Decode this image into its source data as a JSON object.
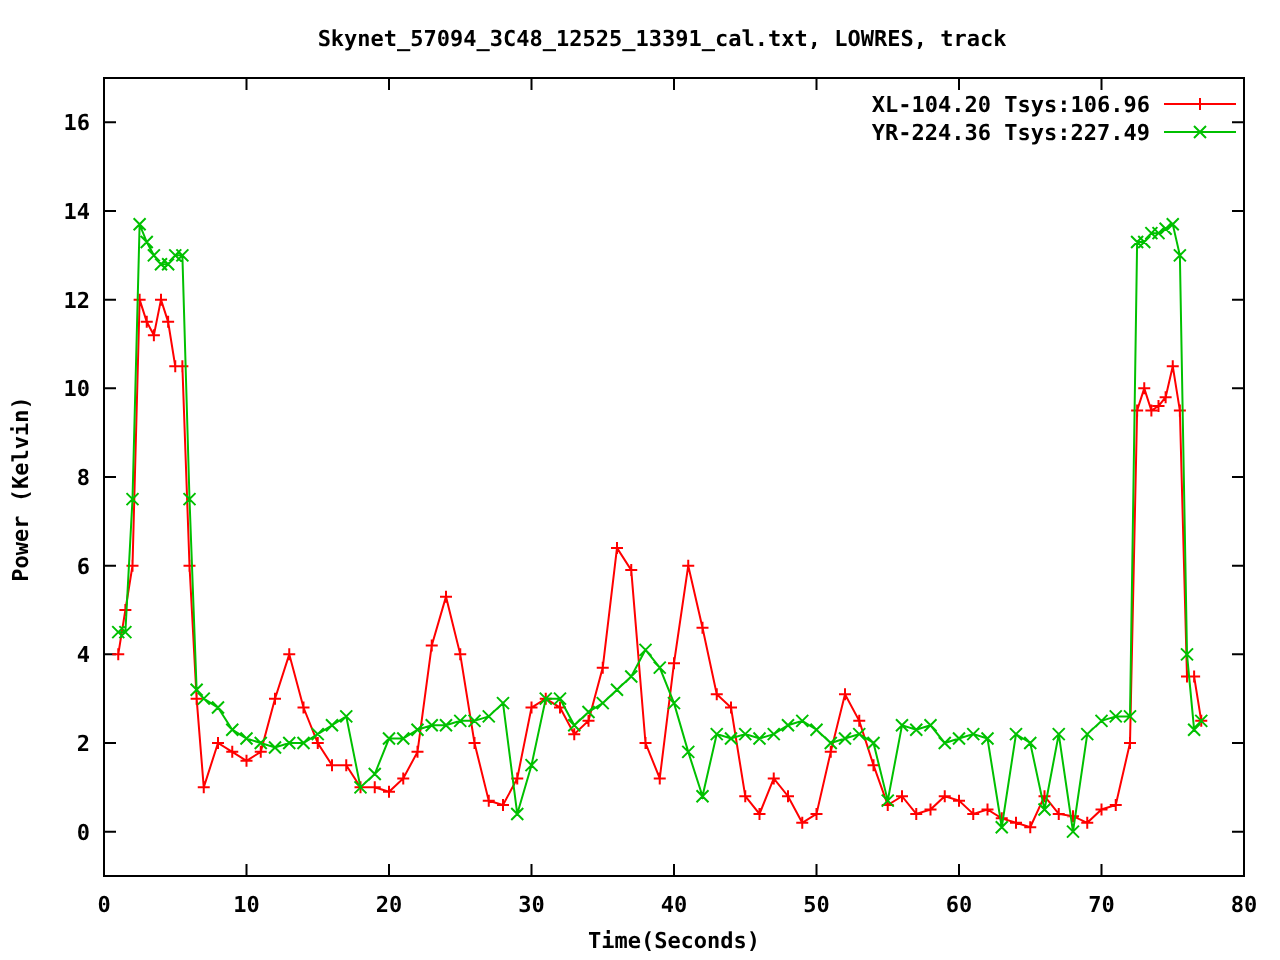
{
  "chart_data": {
    "type": "line",
    "title": "Skynet_57094_3C48_12525_13391_cal.txt, LOWRES, track",
    "xlabel": "Time(Seconds)",
    "ylabel": "Power (Kelvin)",
    "x": [
      1,
      1.5,
      2,
      2.5,
      3,
      3.5,
      4,
      4.5,
      5,
      5.5,
      6,
      6.5,
      7,
      8,
      9,
      10,
      11,
      12,
      13,
      14,
      15,
      16,
      17,
      18,
      19,
      20,
      21,
      22,
      23,
      24,
      25,
      26,
      27,
      28,
      29,
      30,
      31,
      32,
      33,
      34,
      35,
      36,
      37,
      38,
      39,
      40,
      41,
      42,
      43,
      44,
      45,
      46,
      47,
      48,
      49,
      50,
      51,
      52,
      53,
      54,
      55,
      56,
      57,
      58,
      59,
      60,
      61,
      62,
      63,
      64,
      65,
      66,
      67,
      68,
      69,
      70,
      71,
      72,
      72.5,
      73,
      73.5,
      74,
      74.5,
      75,
      75.5,
      76,
      76.5,
      77
    ],
    "series": [
      {
        "name": "XL-104.20 Tsys:106.96",
        "color": "#ff0000",
        "marker": "plus",
        "values": [
          4,
          5,
          6,
          12,
          11.5,
          11.2,
          12,
          11.5,
          10.5,
          10.5,
          6,
          3,
          1,
          2,
          1.8,
          1.6,
          1.8,
          3,
          4,
          2.8,
          2,
          1.5,
          1.5,
          1,
          1,
          0.9,
          1.2,
          1.8,
          4.2,
          5.3,
          4,
          2,
          0.7,
          0.6,
          1.2,
          2.8,
          3,
          2.8,
          2.2,
          2.5,
          3.7,
          6.4,
          5.9,
          2,
          1.2,
          3.8,
          6,
          4.6,
          3.1,
          2.8,
          0.8,
          0.4,
          1.2,
          0.8,
          0.2,
          0.4,
          1.8,
          3.1,
          2.5,
          1.5,
          0.6,
          0.8,
          0.4,
          0.5,
          0.8,
          0.7,
          0.4,
          0.5,
          0.3,
          0.2,
          0.1,
          0.8,
          0.4,
          0.35,
          0.2,
          0.5,
          0.6,
          2,
          9.5,
          10,
          9.5,
          9.6,
          9.8,
          10.5,
          9.5,
          3.5,
          3.5,
          2.5
        ]
      },
      {
        "name": "YR-224.36 Tsys:227.49",
        "color": "#00c000",
        "marker": "cross",
        "values": [
          4.5,
          4.5,
          7.5,
          13.7,
          13.3,
          13,
          12.8,
          12.8,
          13,
          13,
          7.5,
          3.2,
          3,
          2.8,
          2.3,
          2.1,
          2,
          1.9,
          2,
          2,
          2.2,
          2.4,
          2.6,
          1,
          1.3,
          2.1,
          2.1,
          2.3,
          2.4,
          2.4,
          2.5,
          2.5,
          2.6,
          2.9,
          0.4,
          1.5,
          3,
          3,
          2.4,
          2.7,
          2.9,
          3.2,
          3.5,
          4.1,
          3.7,
          2.9,
          1.8,
          0.8,
          2.2,
          2.1,
          2.2,
          2.1,
          2.2,
          2.4,
          2.5,
          2.3,
          2,
          2.1,
          2.2,
          2,
          0.7,
          2.4,
          2.3,
          2.4,
          2,
          2.1,
          2.2,
          2.1,
          0.1,
          2.2,
          2,
          0.5,
          2.2,
          0,
          2.2,
          2.5,
          2.6,
          2.6,
          13.3,
          13.3,
          13.5,
          13.5,
          13.6,
          13.7,
          13,
          4,
          2.3,
          2.5
        ]
      }
    ],
    "legend": true,
    "xlim": [
      0,
      80
    ],
    "ylim": [
      -1,
      17
    ],
    "xticks": [
      0,
      10,
      20,
      30,
      40,
      50,
      60,
      70,
      80
    ],
    "yticks": [
      0,
      2,
      4,
      6,
      8,
      10,
      12,
      14,
      16
    ]
  }
}
